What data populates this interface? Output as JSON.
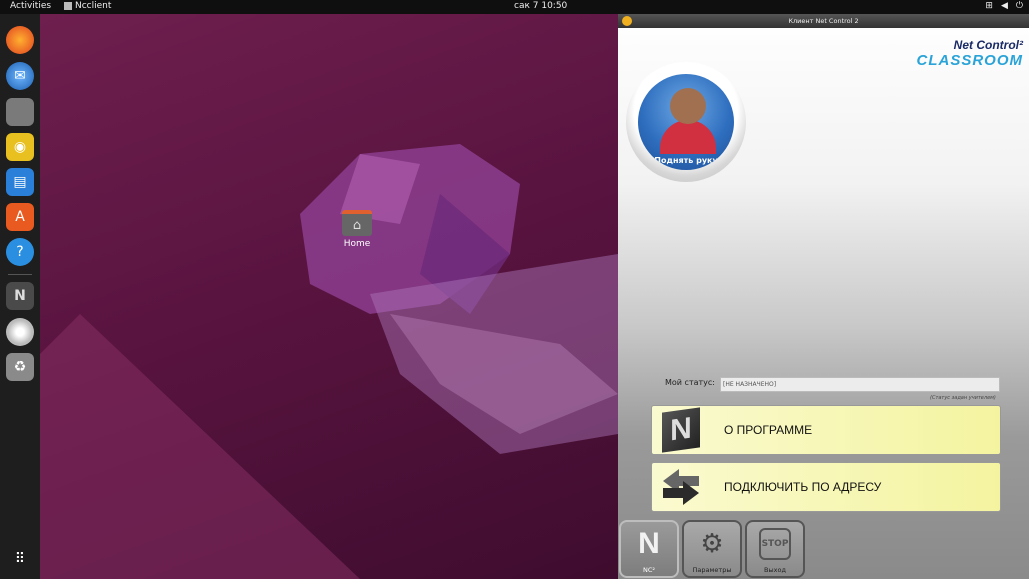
{
  "topbar": {
    "activities": "Activities",
    "app_name": "Ncclient",
    "clock": "сак 7  10:50"
  },
  "desktop": {
    "home_label": "Home"
  },
  "nc_window": {
    "title": "Клиент Net Control 2",
    "logo_line1": "Net Control²",
    "logo_line2": "CLASSROOM",
    "raise_hand_label": "Поднять руку",
    "status_label": "Мой статус:",
    "status_value": "[НЕ НАЗНАЧЕНО]",
    "status_hint": "(Статус задан учителем)",
    "about_button": "О ПРОГРАММЕ",
    "connect_button": "ПОДКЛЮЧИТЬ ПО АДРЕСУ",
    "tools": {
      "nc_label": "NC²",
      "settings_label": "Параметры",
      "exit_label": "Выход",
      "stop_text": "STOP"
    }
  },
  "colors": {
    "desktop_bg": "#5a1440",
    "dock_bg": "#1e1e1e",
    "button_bg": "#f4f4a0",
    "accent_blue": "#2aa3d8"
  },
  "icons": [
    "firefox-icon",
    "thunderbird-icon",
    "files-icon",
    "rhythmbox-icon",
    "writer-icon",
    "software-icon",
    "help-icon",
    "ncclient-icon",
    "disc-icon",
    "trash-icon",
    "app-grid-icon"
  ]
}
